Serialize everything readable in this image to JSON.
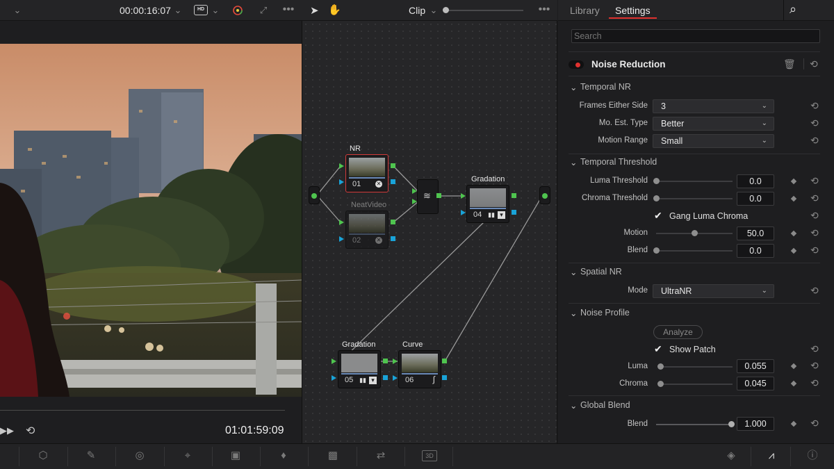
{
  "viewer": {
    "timecode": "00:00:16:07",
    "quality_badge": "HD",
    "timecode_out": "01:01:59:09"
  },
  "node_editor": {
    "mode_label": "Clip",
    "nodes": [
      {
        "num": "01",
        "label": "NR"
      },
      {
        "num": "02",
        "label": "NeatVideo"
      },
      {
        "num": "04",
        "label": "Gradation"
      },
      {
        "num": "05",
        "label": "Gradation"
      },
      {
        "num": "06",
        "label": "Curve"
      }
    ]
  },
  "settings": {
    "tab_library": "Library",
    "tab_settings": "Settings",
    "search_placeholder": "Search",
    "effect_title": "Noise Reduction",
    "temporal_nr": {
      "title": "Temporal NR",
      "frames_label": "Frames Either Side",
      "frames_value": "3",
      "mo_est_label": "Mo. Est. Type",
      "mo_est_value": "Better",
      "motion_range_label": "Motion Range",
      "motion_range_value": "Small"
    },
    "temporal_threshold": {
      "title": "Temporal Threshold",
      "luma_label": "Luma Threshold",
      "luma_value": "0.0",
      "chroma_label": "Chroma Threshold",
      "chroma_value": "0.0",
      "gang_label": "Gang Luma Chroma",
      "motion_label": "Motion",
      "motion_value": "50.0",
      "blend_label": "Blend",
      "blend_value": "0.0"
    },
    "spatial_nr": {
      "title": "Spatial NR",
      "mode_label": "Mode",
      "mode_value": "UltraNR"
    },
    "noise_profile": {
      "title": "Noise Profile",
      "analyze_label": "Analyze",
      "show_patch_label": "Show Patch",
      "luma_label": "Luma",
      "luma_value": "0.055",
      "chroma_label": "Chroma",
      "chroma_value": "0.045"
    },
    "global_blend": {
      "title": "Global Blend",
      "blend_label": "Blend",
      "blend_value": "1.000"
    }
  },
  "colors": {
    "accent_red": "#e0312f",
    "arrow_yellow": "#f5e61a",
    "pin_green": "#4fc44f",
    "pin_blue": "#19a3d8"
  },
  "bottom_toolbar": {
    "icons": [
      "grid-icon",
      "eyedropper-icon",
      "window-icon",
      "tracker-icon",
      "magic-mask-icon",
      "blur-icon",
      "key-icon",
      "sizing-icon",
      "3d-icon",
      "keyframes-icon",
      "scopes-icon",
      "info-icon"
    ],
    "label_3d": "3D"
  }
}
